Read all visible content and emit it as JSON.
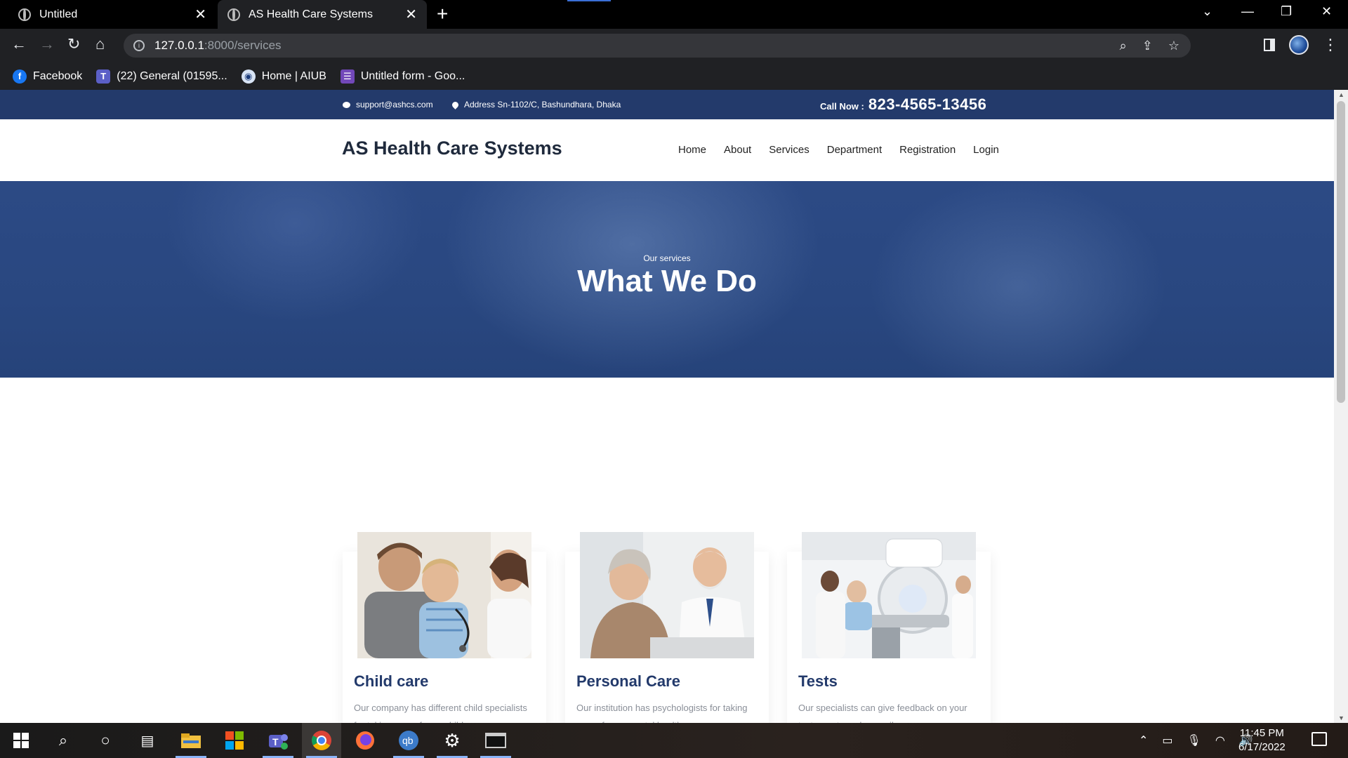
{
  "browser": {
    "tabs": [
      {
        "label": "Untitled",
        "active": false
      },
      {
        "label": "AS Health Care Systems",
        "active": true
      }
    ],
    "url_host": "127.0.0.1",
    "url_rest": ":8000/services",
    "bookmarks": [
      {
        "label": "Facebook",
        "icon": "facebook-icon"
      },
      {
        "label": "(22) General (01595...",
        "icon": "teams-icon"
      },
      {
        "label": "Home | AIUB",
        "icon": "aiub-icon"
      },
      {
        "label": "Untitled form - Goo...",
        "icon": "google-forms-icon"
      }
    ]
  },
  "site": {
    "topbar": {
      "email": "support@ashcs.com",
      "address": "Address Sn-1102/C, Bashundhara, Dhaka",
      "call_label": "Call Now :",
      "call_number": "823-4565-13456"
    },
    "brand": "AS Health Care Systems",
    "menu": [
      "Home",
      "About",
      "Services",
      "Department",
      "Registration",
      "Login"
    ],
    "hero": {
      "subtitle": "Our services",
      "title": "What We Do"
    },
    "services": [
      {
        "title": "Child care",
        "text": "Our company has different child specialists for taking care of your children."
      },
      {
        "title": "Personal Care",
        "text": "Our institution has psychologists for taking care of your mental health."
      },
      {
        "title": "Tests",
        "text": "Our specialists can give feedback on your test reports and prescribe you."
      }
    ]
  },
  "taskbar": {
    "time": "11:45 PM",
    "date": "6/17/2022"
  },
  "colors": {
    "brand_navy": "#233a6b",
    "hero_blue": "#2c4a85",
    "chrome_dark": "#202124"
  }
}
